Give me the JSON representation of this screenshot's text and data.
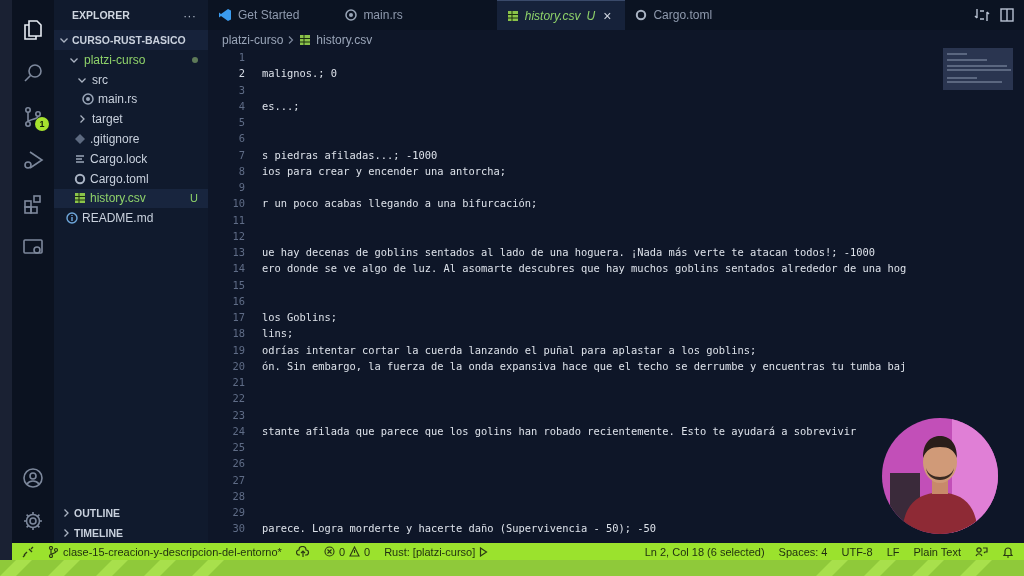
{
  "activity_bar": {
    "items": [
      {
        "kind": "explorer",
        "selected": true
      },
      {
        "kind": "search",
        "selected": false
      },
      {
        "kind": "source-control",
        "selected": false,
        "badge": "1"
      },
      {
        "kind": "debug",
        "selected": false
      },
      {
        "kind": "extensions",
        "selected": false
      },
      {
        "kind": "remote",
        "selected": false
      }
    ],
    "bottom": [
      {
        "kind": "account"
      },
      {
        "kind": "settings"
      }
    ]
  },
  "sidebar": {
    "title": "EXPLORER",
    "actions": "···",
    "root": {
      "label": "CURSO-RUST-BASICO",
      "expanded": true
    },
    "tree": [
      {
        "label": "platzi-curso",
        "kind": "folder",
        "expanded": true,
        "selected": false,
        "untracked": true,
        "changes_dot": true,
        "children": [
          {
            "label": "src",
            "kind": "folder",
            "expanded": true,
            "selected": false,
            "untracked": false,
            "changes_dot": false,
            "children": [
              {
                "label": "main.rs",
                "kind": "rust",
                "selected": false,
                "untracked": false,
                "changes_dot": false
              }
            ]
          },
          {
            "label": "target",
            "kind": "folder",
            "expanded": false,
            "selected": false,
            "untracked": false,
            "changes_dot": false
          },
          {
            "label": ".gitignore",
            "kind": "ignore",
            "selected": false,
            "untracked": false,
            "changes_dot": false
          },
          {
            "label": "Cargo.lock",
            "kind": "lock",
            "selected": false,
            "untracked": false,
            "changes_dot": false
          },
          {
            "label": "Cargo.toml",
            "kind": "toml",
            "selected": false,
            "untracked": false,
            "changes_dot": false
          },
          {
            "label": "history.csv",
            "kind": "csv",
            "selected": true,
            "untracked": true,
            "changes_dot": false,
            "badge": "U"
          }
        ]
      },
      {
        "label": "README.md",
        "kind": "info",
        "selected": false,
        "untracked": false,
        "changes_dot": false
      }
    ],
    "sections": [
      {
        "label": "OUTLINE",
        "expanded": false
      },
      {
        "label": "TIMELINE",
        "expanded": false
      }
    ]
  },
  "tabs": [
    {
      "label": "Get Started",
      "kind": "vscode",
      "selected": false,
      "preview": false,
      "untracked": false
    },
    {
      "label": "main.rs",
      "kind": "rust",
      "selected": false,
      "preview": false,
      "untracked": false
    },
    {
      "label": "history.csv",
      "kind": "csv",
      "selected": true,
      "preview": true,
      "untracked": true,
      "badge": "U",
      "close": "×"
    },
    {
      "label": "Cargo.toml",
      "kind": "toml",
      "selected": false,
      "preview": false,
      "untracked": false
    }
  ],
  "breadcrumb": [
    {
      "label": "platzi-curso",
      "kind": "folder"
    },
    {
      "label": "history.csv",
      "kind": "csv"
    }
  ],
  "editor": {
    "lines": [
      {
        "number": "1",
        "current": false
      },
      {
        "number": "2",
        "current": true,
        "text": "malignos.; 0"
      },
      {
        "number": "3",
        "current": false
      },
      {
        "number": "4",
        "current": false,
        "text": "es...;"
      },
      {
        "number": "5",
        "current": false
      },
      {
        "number": "6",
        "current": false
      },
      {
        "number": "7",
        "current": false,
        "text": "s piedras afiladas...; -1000"
      },
      {
        "number": "8",
        "current": false,
        "text": "ios para crear y encender una antorcha;"
      },
      {
        "number": "9",
        "current": false
      },
      {
        "number": "10",
        "current": false,
        "text": "r un poco acabas llegando a una bifurcación;"
      },
      {
        "number": "11",
        "current": false
      },
      {
        "number": "12",
        "current": false
      },
      {
        "number": "13",
        "current": false,
        "text": "ue hay decenas de goblins sentados al lado de una hoguera. ¡Nada más verte te atacan todos!; -1000"
      },
      {
        "number": "14",
        "current": false,
        "text": "ero donde se ve algo de luz. Al asomarte descubres que hay muchos goblins sentados alrededor de una hog"
      },
      {
        "number": "15",
        "current": false
      },
      {
        "number": "16",
        "current": false
      },
      {
        "number": "17",
        "current": false,
        "text": "los Goblins;"
      },
      {
        "number": "18",
        "current": false,
        "text": "lins;"
      },
      {
        "number": "19",
        "current": false,
        "text": "odrías intentar cortar la cuerda lanzando el puñal para aplastar a los goblins;"
      },
      {
        "number": "20",
        "current": false,
        "text": "ón. Sin embargo, la fuerza de la onda expansiva hace que el techo se derrumbe y encuentras tu tumba baj"
      },
      {
        "number": "21",
        "current": false
      },
      {
        "number": "22",
        "current": false
      },
      {
        "number": "23",
        "current": false
      },
      {
        "number": "24",
        "current": false,
        "text": "stante afilada que parece que los golins han robado recientemente. Esto te ayudará a sobrevivir"
      },
      {
        "number": "25",
        "current": false
      },
      {
        "number": "26",
        "current": false
      },
      {
        "number": "27",
        "current": false
      },
      {
        "number": "28",
        "current": false
      },
      {
        "number": "29",
        "current": false
      },
      {
        "number": "30",
        "current": false,
        "text": "parece. Logra morderte y hacerte daño (Supervivencia - 50); -50"
      }
    ]
  },
  "status_bar": {
    "left": [
      {
        "kind": "remote"
      },
      {
        "kind": "branch",
        "text": "clase-15-creacion-y-descripcion-del-entorno*"
      },
      {
        "kind": "sync"
      },
      {
        "kind": "problems",
        "errors": "0",
        "warnings": "0"
      },
      {
        "kind": "run",
        "text": "Rust: [platzi-curso]"
      }
    ],
    "right": [
      {
        "kind": "text",
        "text": "Ln 2, Col 18 (6 selected)"
      },
      {
        "kind": "text",
        "text": "Spaces: 4"
      },
      {
        "kind": "text",
        "text": "UTF-8"
      },
      {
        "kind": "text",
        "text": "LF"
      },
      {
        "kind": "text",
        "text": "Plain Text"
      },
      {
        "kind": "feedback"
      },
      {
        "kind": "bell"
      }
    ]
  }
}
